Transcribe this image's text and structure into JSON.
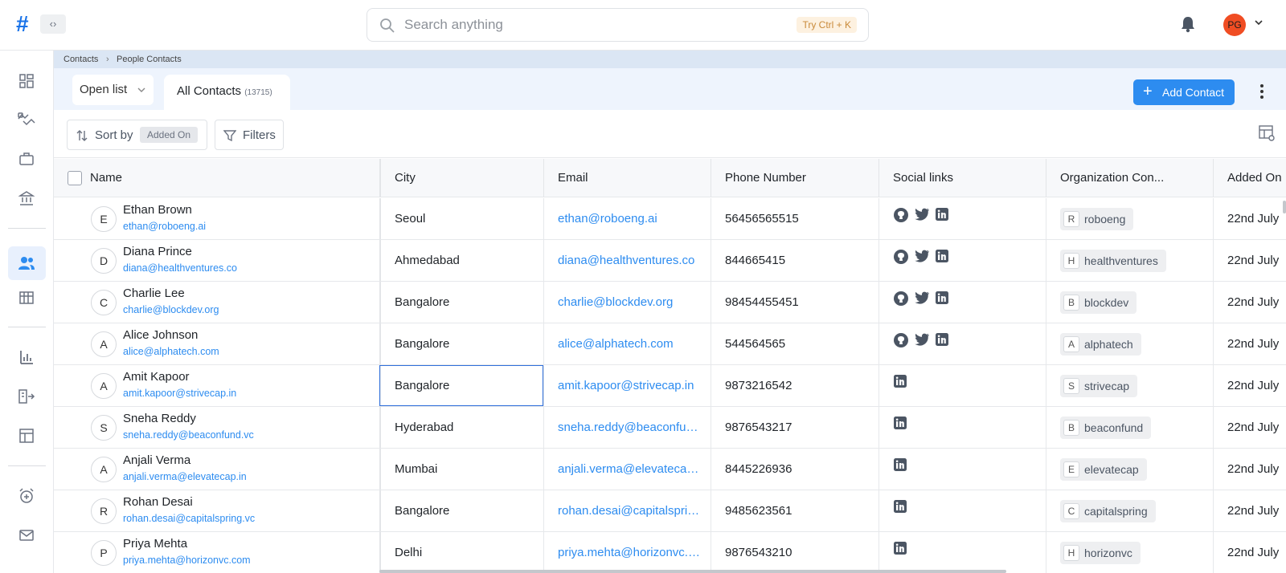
{
  "app": {
    "logo": "#",
    "toggle": "‹›"
  },
  "search": {
    "placeholder": "Search anything",
    "shortcut": "Try Ctrl + K"
  },
  "user": {
    "initials": "PG"
  },
  "breadcrumb": {
    "root": "Contacts",
    "separator": "›",
    "current": "People Contacts"
  },
  "tabs": {
    "open_list": "Open list",
    "active_label": "All Contacts",
    "active_count": "(13715)"
  },
  "actions": {
    "add_contact": "Add Contact"
  },
  "toolbar": {
    "sort_label": "Sort by",
    "sort_value": "Added On",
    "filters_label": "Filters"
  },
  "table": {
    "columns": [
      "Name",
      "City",
      "Email",
      "Phone Number",
      "Social links",
      "Organization Con...",
      "Added On"
    ],
    "rows": [
      {
        "initial": "E",
        "name": "Ethan Brown",
        "sub_email": "ethan@roboeng.ai",
        "city": "Seoul",
        "email": "ethan@roboeng.ai",
        "phone": "56456565515",
        "social": [
          "github-icon",
          "twitter-icon",
          "linkedin-icon"
        ],
        "org_letter": "R",
        "org": "roboeng",
        "added": "22nd July"
      },
      {
        "initial": "D",
        "name": "Diana Prince",
        "sub_email": "diana@healthventures.co",
        "city": "Ahmedabad",
        "email": "diana@healthventures.co",
        "phone": "844665415",
        "social": [
          "github-icon",
          "twitter-icon",
          "linkedin-icon"
        ],
        "org_letter": "H",
        "org": "healthventures",
        "added": "22nd July"
      },
      {
        "initial": "C",
        "name": "Charlie Lee",
        "sub_email": "charlie@blockdev.org",
        "city": "Bangalore",
        "email": "charlie@blockdev.org",
        "phone": "98454455451",
        "social": [
          "github-icon",
          "twitter-icon",
          "linkedin-icon"
        ],
        "org_letter": "B",
        "org": "blockdev",
        "added": "22nd July"
      },
      {
        "initial": "A",
        "name": "Alice Johnson",
        "sub_email": "alice@alphatech.com",
        "city": "Bangalore",
        "email": "alice@alphatech.com",
        "phone": "544564565",
        "social": [
          "github-icon",
          "twitter-icon",
          "linkedin-icon"
        ],
        "org_letter": "A",
        "org": "alphatech",
        "added": "22nd July"
      },
      {
        "initial": "A",
        "name": "Amit Kapoor",
        "sub_email": "amit.kapoor@strivecap.in",
        "city": "Bangalore",
        "email": "amit.kapoor@strivecap.in",
        "phone": "9873216542",
        "social": [
          "linkedin-icon"
        ],
        "org_letter": "S",
        "org": "strivecap",
        "added": "22nd July"
      },
      {
        "initial": "S",
        "name": "Sneha Reddy",
        "sub_email": "sneha.reddy@beaconfund.vc",
        "city": "Hyderabad",
        "email": "sneha.reddy@beaconfund.vc",
        "phone": "9876543217",
        "social": [
          "linkedin-icon"
        ],
        "org_letter": "B",
        "org": "beaconfund",
        "added": "22nd July"
      },
      {
        "initial": "A",
        "name": "Anjali Verma",
        "sub_email": "anjali.verma@elevatecap.in",
        "city": "Mumbai",
        "email": "anjali.verma@elevatecap.in",
        "phone": "8445226936",
        "social": [
          "linkedin-icon"
        ],
        "org_letter": "E",
        "org": "elevatecap",
        "added": "22nd July"
      },
      {
        "initial": "R",
        "name": "Rohan Desai",
        "sub_email": "rohan.desai@capitalspring.vc",
        "city": "Bangalore",
        "email": "rohan.desai@capitalspring.vc",
        "phone": "9485623561",
        "social": [
          "linkedin-icon"
        ],
        "org_letter": "C",
        "org": "capitalspring",
        "added": "22nd July"
      },
      {
        "initial": "P",
        "name": "Priya Mehta",
        "sub_email": "priya.mehta@horizonvc.com",
        "city": "Delhi",
        "email": "priya.mehta@horizonvc.com",
        "phone": "9876543210",
        "social": [
          "linkedin-icon"
        ],
        "org_letter": "H",
        "org": "horizonvc",
        "added": "22nd July"
      }
    ]
  },
  "colors": {
    "accent": "#2d8cf0",
    "brand": "#1a73e8",
    "avatar_bg": "#f04d23"
  }
}
